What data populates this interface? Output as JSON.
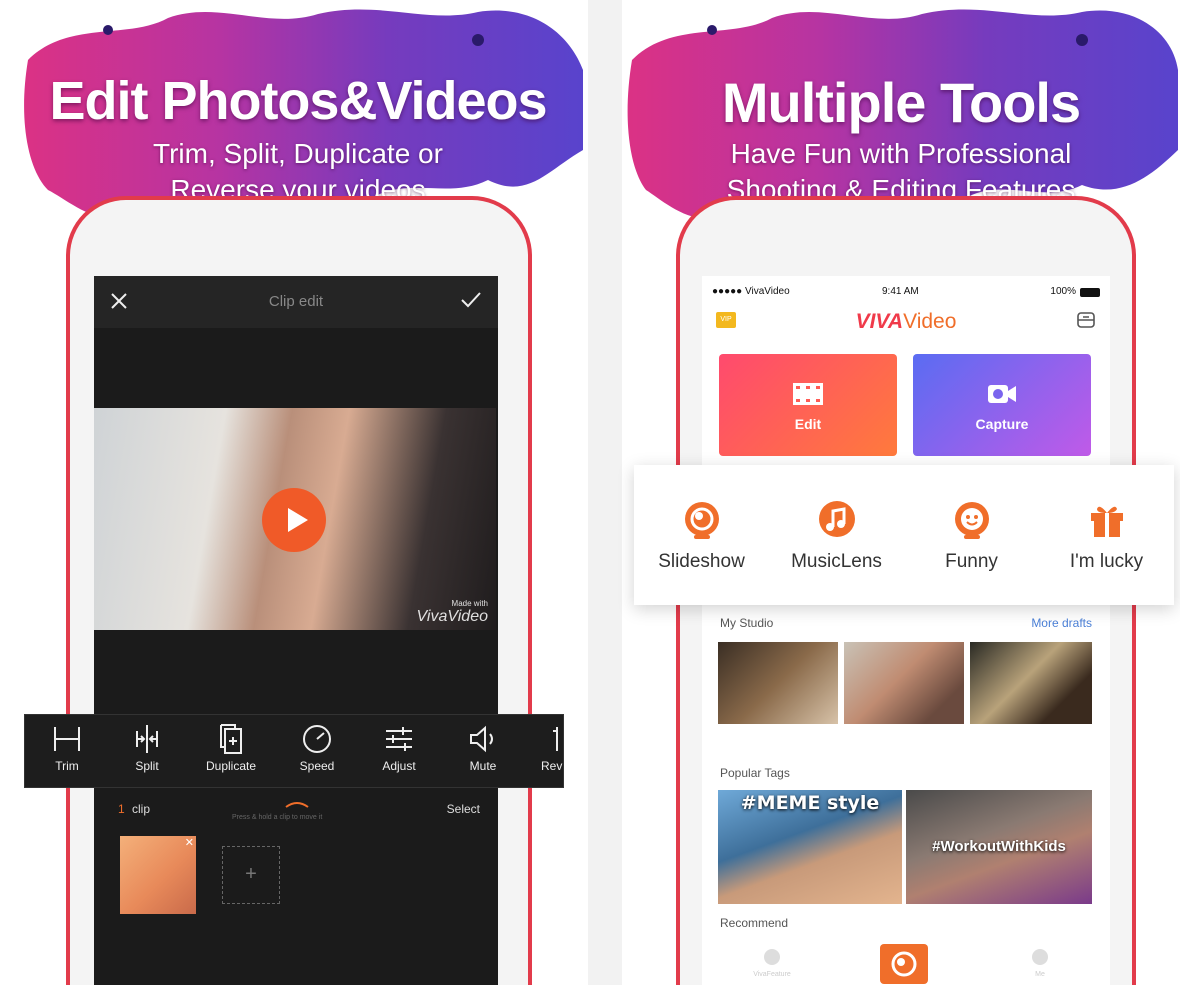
{
  "left_panel": {
    "banner_title": "Edit Photos&Videos",
    "banner_subtitle_line1": "Trim, Split, Duplicate or",
    "banner_subtitle_line2": "Reverse your videos",
    "screen": {
      "header_title": "Clip edit",
      "watermark_line1": "Made with",
      "watermark_line2": "VivaVideo",
      "toolbar": [
        {
          "label": "Trim",
          "icon": "trim-icon"
        },
        {
          "label": "Split",
          "icon": "split-icon"
        },
        {
          "label": "Duplicate",
          "icon": "duplicate-icon"
        },
        {
          "label": "Speed",
          "icon": "speed-icon"
        },
        {
          "label": "Adjust",
          "icon": "adjust-icon"
        },
        {
          "label": "Mute",
          "icon": "mute-icon"
        },
        {
          "label": "Rev",
          "icon": "reverse-icon"
        }
      ],
      "clip_count": "1",
      "clip_label": "clip",
      "hint": "Press & hold a clip to move it",
      "select_label": "Select",
      "add_symbol": "+"
    }
  },
  "right_panel": {
    "banner_title": "Multiple Tools",
    "banner_subtitle_line1": "Have Fun with Professional",
    "banner_subtitle_line2": "Shooting & Editing Features",
    "screen": {
      "status_carrier": "●●●●● VivaVideo",
      "status_time": "9:41 AM",
      "status_battery": "100%",
      "vip_badge": "VIP",
      "logo_viva": "VIVA",
      "logo_video": "Video",
      "edit_label": "Edit",
      "capture_label": "Capture",
      "quick_tools": [
        {
          "label": "Slideshow",
          "icon": "slideshow-icon"
        },
        {
          "label": "MusicLens",
          "icon": "music-note-icon"
        },
        {
          "label": "Funny",
          "icon": "funny-face-icon"
        },
        {
          "label": "I'm lucky",
          "icon": "gift-icon"
        }
      ],
      "my_studio_label": "My Studio",
      "more_drafts_label": "More drafts",
      "popular_tags_label": "Popular Tags",
      "tag1": "#MEME style",
      "tag2": "#WorkoutWithKids",
      "recommend_label": "Recommend",
      "nav_left": "VivaFeature",
      "nav_right": "Me"
    }
  },
  "colors": {
    "phone_red": "#e23b4b",
    "play_orange": "#f05a28",
    "edit_gradient_start": "#ff4a6e",
    "edit_gradient_end": "#ff7a3c",
    "capture_gradient_start": "#5a6cf2",
    "capture_gradient_end": "#c05ae8",
    "accent_orange": "#f06e2a",
    "link_blue": "#4a7fd6"
  }
}
